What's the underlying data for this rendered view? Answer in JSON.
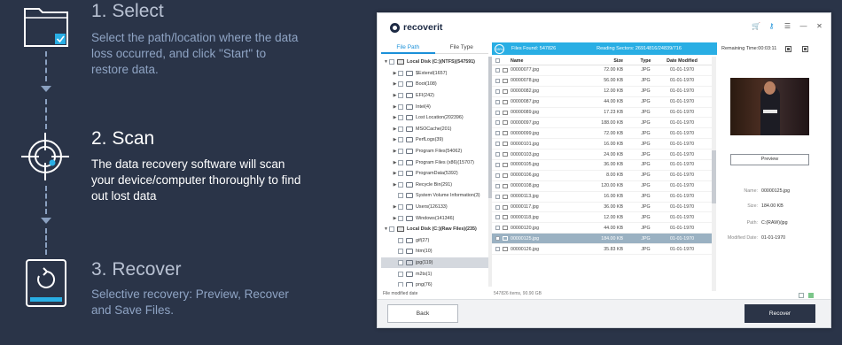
{
  "steps": [
    {
      "title": "1. Select",
      "description": "Select the path/location where the data loss occurred, and click \"Start\" to restore data.",
      "icon": "folder-check-icon"
    },
    {
      "title": "2. Scan",
      "description": "The data recovery software will scan your device/computer thoroughly to find out lost data",
      "icon": "target-crosshair-icon"
    },
    {
      "title": "3. Recover",
      "description": "Selective recovery: Preview, Recover and Save Files.",
      "icon": "restore-device-icon"
    }
  ],
  "app": {
    "name": "recoverit",
    "tabs": [
      "File Path",
      "File Type"
    ],
    "active_tab": "File Path",
    "status": {
      "percent": "55%",
      "files_found": "Files Found: 547826",
      "reading_sectors": "Reading Sectors: 26914816/24839/716",
      "remaining": "Remaining Time:00:03:11"
    },
    "tree": [
      {
        "label": "Local Disk (C:)(NTFS)(547591)",
        "level": 0,
        "kind": "disk",
        "twisty": "▼"
      },
      {
        "label": "$Extend(1657)",
        "level": 1,
        "kind": "folder",
        "twisty": "▶"
      },
      {
        "label": "Boot(108)",
        "level": 1,
        "kind": "folder",
        "twisty": "▶"
      },
      {
        "label": "EFI(242)",
        "level": 1,
        "kind": "folder",
        "twisty": "▶"
      },
      {
        "label": "Intel(4)",
        "level": 1,
        "kind": "folder",
        "twisty": "▶"
      },
      {
        "label": "Lost Location(202396)",
        "level": 1,
        "kind": "folder",
        "twisty": "▶"
      },
      {
        "label": "MSOCache(201)",
        "level": 1,
        "kind": "folder",
        "twisty": "▶"
      },
      {
        "label": "PerfLogs(39)",
        "level": 1,
        "kind": "folder",
        "twisty": "▶"
      },
      {
        "label": "Program Files(54062)",
        "level": 1,
        "kind": "folder",
        "twisty": "▶"
      },
      {
        "label": "Program Files (x86)(15707)",
        "level": 1,
        "kind": "folder",
        "twisty": "▶"
      },
      {
        "label": "ProgramData(5392)",
        "level": 1,
        "kind": "folder",
        "twisty": "▶"
      },
      {
        "label": "Recycle Bin(291)",
        "level": 1,
        "kind": "folder",
        "twisty": "▶"
      },
      {
        "label": "System Volume Information(3)",
        "level": 1,
        "kind": "folder",
        "twisty": ""
      },
      {
        "label": "Users(126133)",
        "level": 1,
        "kind": "folder",
        "twisty": "▶"
      },
      {
        "label": "Windows(141346)",
        "level": 1,
        "kind": "folder",
        "twisty": "▶"
      },
      {
        "label": "Local Disk (C:)(Raw Files)(235)",
        "level": 0,
        "kind": "disk",
        "twisty": "▼"
      },
      {
        "label": "gif(27)",
        "level": 1,
        "kind": "folder",
        "twisty": ""
      },
      {
        "label": "htm(10)",
        "level": 1,
        "kind": "folder",
        "twisty": ""
      },
      {
        "label": "jpg(119)",
        "level": 1,
        "kind": "folder",
        "twisty": "",
        "selected": true
      },
      {
        "label": "m2ts(1)",
        "level": 1,
        "kind": "folder",
        "twisty": ""
      },
      {
        "label": "png(76)",
        "level": 1,
        "kind": "folder",
        "twisty": ""
      }
    ],
    "tree_footer": "File modified date",
    "table": {
      "headers": [
        "Name",
        "Size",
        "Type",
        "Date Modified"
      ],
      "rows": [
        {
          "name": "00000077.jpg",
          "size": "72.00  KB",
          "type": "JPG",
          "date": "01-01-1970"
        },
        {
          "name": "00000078.jpg",
          "size": "56.00  KB",
          "type": "JPG",
          "date": "01-01-1970"
        },
        {
          "name": "00000082.jpg",
          "size": "12.00  KB",
          "type": "JPG",
          "date": "01-01-1970"
        },
        {
          "name": "00000087.jpg",
          "size": "44.00  KB",
          "type": "JPG",
          "date": "01-01-1970"
        },
        {
          "name": "00000089.jpg",
          "size": "17.23  KB",
          "type": "JPG",
          "date": "01-01-1970"
        },
        {
          "name": "00000097.jpg",
          "size": "188.00  KB",
          "type": "JPG",
          "date": "01-01-1970"
        },
        {
          "name": "00000099.jpg",
          "size": "72.00  KB",
          "type": "JPG",
          "date": "01-01-1970"
        },
        {
          "name": "00000101.jpg",
          "size": "16.00  KB",
          "type": "JPG",
          "date": "01-01-1970"
        },
        {
          "name": "00000103.jpg",
          "size": "24.00  KB",
          "type": "JPG",
          "date": "01-01-1970"
        },
        {
          "name": "00000105.jpg",
          "size": "36.00  KB",
          "type": "JPG",
          "date": "01-01-1970"
        },
        {
          "name": "00000106.jpg",
          "size": "8.00  KB",
          "type": "JPG",
          "date": "01-01-1970"
        },
        {
          "name": "00000108.jpg",
          "size": "120.00  KB",
          "type": "JPG",
          "date": "01-01-1970"
        },
        {
          "name": "00000113.jpg",
          "size": "16.00  KB",
          "type": "JPG",
          "date": "01-01-1970"
        },
        {
          "name": "00000117.jpg",
          "size": "36.00  KB",
          "type": "JPG",
          "date": "01-01-1970"
        },
        {
          "name": "00000118.jpg",
          "size": "12.00  KB",
          "type": "JPG",
          "date": "01-01-1970"
        },
        {
          "name": "00000120.jpg",
          "size": "44.00  KB",
          "type": "JPG",
          "date": "01-01-1970"
        },
        {
          "name": "00000125.jpg",
          "size": "184.00  KB",
          "type": "JPG",
          "date": "01-01-1970",
          "selected": true
        },
        {
          "name": "00000126.jpg",
          "size": "35.83  KB",
          "type": "JPG",
          "date": "01-01-1970"
        }
      ]
    },
    "table_footer": "547826 items, 90.90  GB",
    "preview": {
      "button": "Preview",
      "name_label": "Name:",
      "name_value": "00000125.jpg",
      "size_label": "Size:",
      "size_value": "184.00 KB",
      "path_label": "Path:",
      "path_value": "C:(RAW)/jpg",
      "date_label": "Modified Date:",
      "date_value": "01-01-1970"
    },
    "back_label": "Back",
    "recover_label": "Recover"
  },
  "colors": {
    "background": "#2a3448",
    "accent": "#29aee4",
    "step_icon_accent": "#29aee4"
  }
}
